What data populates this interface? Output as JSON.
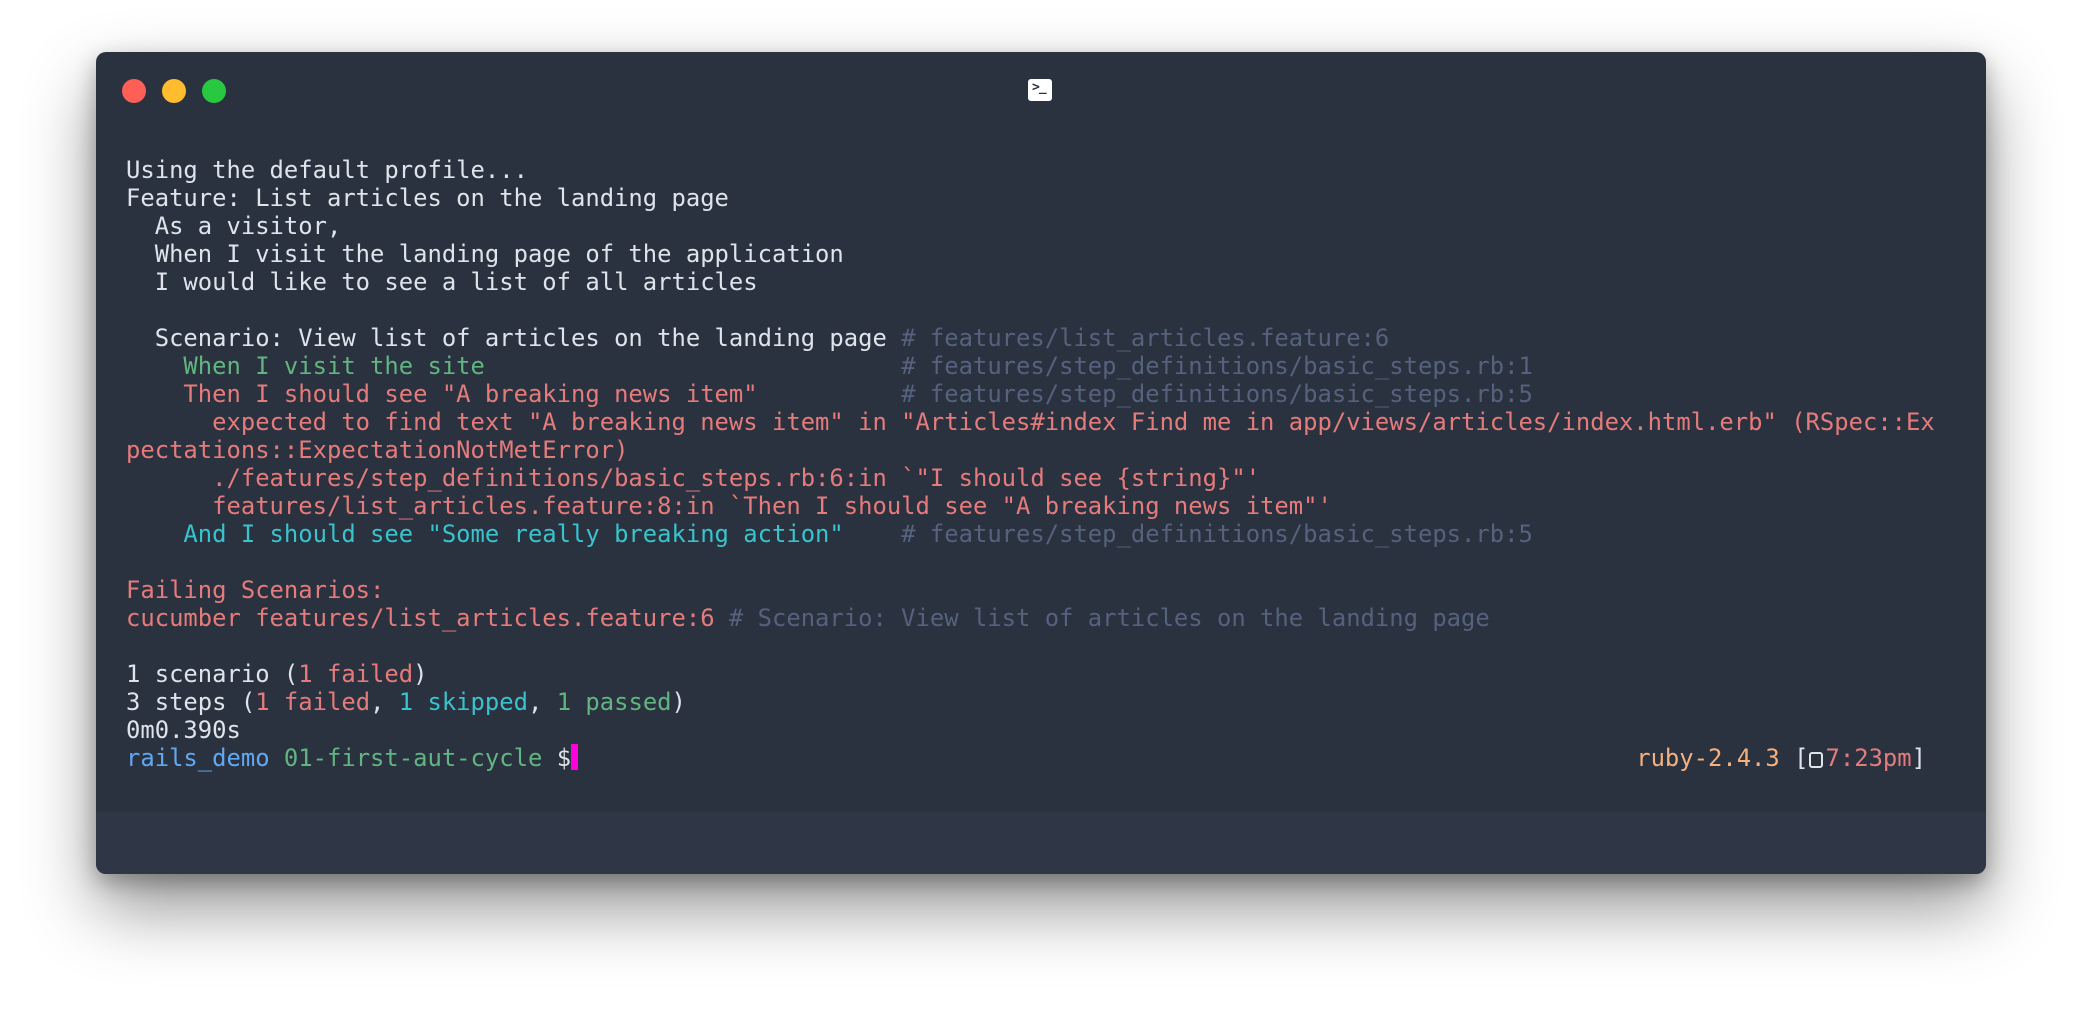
{
  "window": {
    "title_icon": "terminal-icon"
  },
  "terminal": {
    "lines": [
      {
        "segments": [
          {
            "text": "Using the default profile...",
            "color": "white"
          }
        ]
      },
      {
        "segments": [
          {
            "text": "Feature: List articles on the landing page",
            "color": "white"
          }
        ]
      },
      {
        "segments": [
          {
            "text": "  As a visitor,",
            "color": "white"
          }
        ]
      },
      {
        "segments": [
          {
            "text": "  When I visit the landing page of the application",
            "color": "white"
          }
        ]
      },
      {
        "segments": [
          {
            "text": "  I would like to see a list of all articles",
            "color": "white"
          }
        ]
      },
      {
        "segments": []
      },
      {
        "segments": [
          {
            "text": "  Scenario: View list of articles on the landing page ",
            "color": "white"
          },
          {
            "text": "# features/list_articles.feature:6",
            "color": "comment"
          }
        ]
      },
      {
        "segments": [
          {
            "text": "    When I visit the site                             ",
            "color": "green"
          },
          {
            "text": "# features/step_definitions/basic_steps.rb:1",
            "color": "comment"
          }
        ]
      },
      {
        "segments": [
          {
            "text": "    Then I should see \"A breaking news item\"          ",
            "color": "red"
          },
          {
            "text": "# features/step_definitions/basic_steps.rb:5",
            "color": "comment"
          }
        ]
      },
      {
        "segments": [
          {
            "text": "      expected to find text \"A breaking news item\" in \"Articles#index Find me in app/views/articles/index.html.erb\" (RSpec::Ex",
            "color": "red"
          }
        ]
      },
      {
        "segments": [
          {
            "text": "pectations::ExpectationNotMetError)",
            "color": "red"
          }
        ]
      },
      {
        "segments": [
          {
            "text": "      ./features/step_definitions/basic_steps.rb:6:in `\"I should see {string}\"'",
            "color": "red"
          }
        ]
      },
      {
        "segments": [
          {
            "text": "      features/list_articles.feature:8:in `Then I should see \"A breaking news item\"'",
            "color": "red"
          }
        ]
      },
      {
        "segments": [
          {
            "text": "    And I should see \"Some really breaking action\"    ",
            "color": "cyan"
          },
          {
            "text": "# features/step_definitions/basic_steps.rb:5",
            "color": "comment"
          }
        ]
      },
      {
        "segments": []
      },
      {
        "segments": [
          {
            "text": "Failing Scenarios:",
            "color": "red"
          }
        ]
      },
      {
        "segments": [
          {
            "text": "cucumber features/list_articles.feature:6",
            "color": "red"
          },
          {
            "text": " # Scenario: View list of articles on the landing page",
            "color": "comment"
          }
        ]
      },
      {
        "segments": []
      },
      {
        "segments": [
          {
            "text": "1 scenario (",
            "color": "white"
          },
          {
            "text": "1 failed",
            "color": "red"
          },
          {
            "text": ")",
            "color": "white"
          }
        ]
      },
      {
        "segments": [
          {
            "text": "3 steps (",
            "color": "white"
          },
          {
            "text": "1 failed",
            "color": "red"
          },
          {
            "text": ", ",
            "color": "white"
          },
          {
            "text": "1 skipped",
            "color": "cyan"
          },
          {
            "text": ", ",
            "color": "white"
          },
          {
            "text": "1 passed",
            "color": "green"
          },
          {
            "text": ")",
            "color": "white"
          }
        ]
      },
      {
        "segments": [
          {
            "text": "0m0.390s",
            "color": "white"
          }
        ]
      }
    ],
    "prompt": {
      "directory": "rails_demo",
      "branch": "01-first-aut-cycle",
      "symbol": "$",
      "ruby_version": "ruby-2.4.3",
      "bracket_open": "[",
      "clock_icon": "clock-icon",
      "time": "7:23pm",
      "bracket_close": "]"
    }
  },
  "colors": {
    "white": "#dfe3ea",
    "comment": "#56627d",
    "green": "#62b480",
    "red": "#e57b7b",
    "cyan": "#39c3cc",
    "blue": "#61a8f0",
    "orange": "#f6b07d",
    "cursor": "#ff00dd",
    "background": "#2a3240"
  }
}
